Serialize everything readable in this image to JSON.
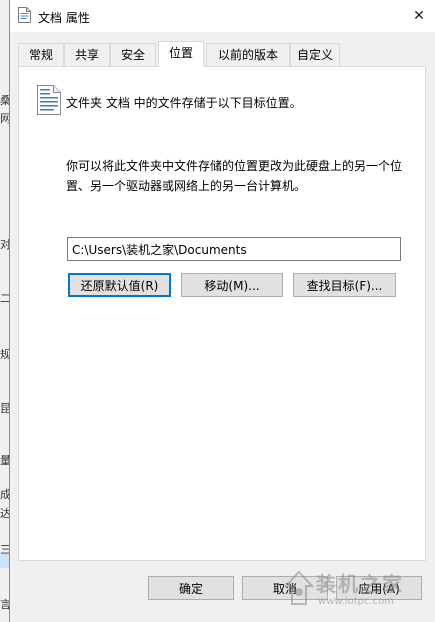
{
  "window": {
    "title": "文档 属性",
    "close_glyph": "✕"
  },
  "tabs": [
    {
      "label": "常规",
      "active": false
    },
    {
      "label": "共享",
      "active": false
    },
    {
      "label": "安全",
      "active": false
    },
    {
      "label": "位置",
      "active": true
    },
    {
      "label": "以前的版本",
      "active": false
    },
    {
      "label": "自定义",
      "active": false
    }
  ],
  "location": {
    "heading": "文件夹 文档 中的文件存储于以下目标位置。",
    "description": "你可以将此文件夹中文件存储的位置更改为此硬盘上的另一个位置、另一个驱动器或网络上的另一台计算机。",
    "path": "C:\\Users\\装机之家\\Documents",
    "restore_label": "还原默认值(R)",
    "move_label": "移动(M)...",
    "find_label": "查找目标(F)..."
  },
  "footer": {
    "ok_label": "确定",
    "cancel_label": "取消",
    "apply_label": "应用(A)"
  },
  "watermark": {
    "text": "装机之家",
    "url": "www.lotpc.com"
  },
  "background_fragments": [
    "桑",
    "网",
    "对",
    "二",
    "规",
    "昆",
    "量",
    "成",
    "达",
    "三",
    "言"
  ],
  "colors": {
    "accent": "#0078d7",
    "dialog_bg": "#f0f0f0",
    "panel_bg": "#ffffff",
    "button_bg": "#e1e1e1"
  }
}
